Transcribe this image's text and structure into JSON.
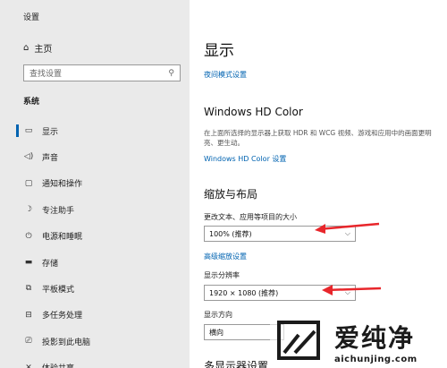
{
  "window": {
    "title": "设置",
    "minimize_glyph": "—",
    "maximize_glyph": "□",
    "close_glyph": "✕"
  },
  "sidebar": {
    "home_label": "主页",
    "search_placeholder": "查找设置",
    "section_label": "系统",
    "items": [
      {
        "label": "显示",
        "icon": "monitor-icon",
        "glyph": "▭",
        "selected": true
      },
      {
        "label": "声音",
        "icon": "speaker-icon",
        "glyph": "◁)",
        "selected": false
      },
      {
        "label": "通知和操作",
        "icon": "notification-icon",
        "glyph": "▢",
        "selected": false
      },
      {
        "label": "专注助手",
        "icon": "moon-icon",
        "glyph": "☽",
        "selected": false
      },
      {
        "label": "电源和睡眠",
        "icon": "power-icon",
        "glyph": "⏻",
        "selected": false
      },
      {
        "label": "存储",
        "icon": "storage-icon",
        "glyph": "▬",
        "selected": false
      },
      {
        "label": "平板模式",
        "icon": "tablet-icon",
        "glyph": "⧉",
        "selected": false
      },
      {
        "label": "多任务处理",
        "icon": "multitask-icon",
        "glyph": "⊟",
        "selected": false
      },
      {
        "label": "投影到此电脑",
        "icon": "projection-icon",
        "glyph": "⎚",
        "selected": false
      },
      {
        "label": "体验共享",
        "icon": "share-icon",
        "glyph": "✕",
        "selected": false
      }
    ]
  },
  "main": {
    "title": "显示",
    "night_light_link": "夜间模式设置",
    "hd_color": {
      "heading": "Windows HD Color",
      "description": "在上面所选择的显示器上获取 HDR 和 WCG 视频、游戏和应用中的画面更明亮、更生动。",
      "link": "Windows HD Color 设置"
    },
    "scale_layout": {
      "heading": "缩放与布局",
      "scale_label": "更改文本、应用等项目的大小",
      "scale_value": "100% (推荐)",
      "advanced_link": "高级缩放设置",
      "resolution_label": "显示分辨率",
      "resolution_value": "1920 × 1080 (推荐)",
      "orientation_label": "显示方向",
      "orientation_value": "横向"
    },
    "multi_display_heading": "多显示器设置"
  },
  "annotation_color": "#e8262b",
  "watermark": {
    "brand": "爱纯净",
    "url": "aichunjing.com"
  }
}
